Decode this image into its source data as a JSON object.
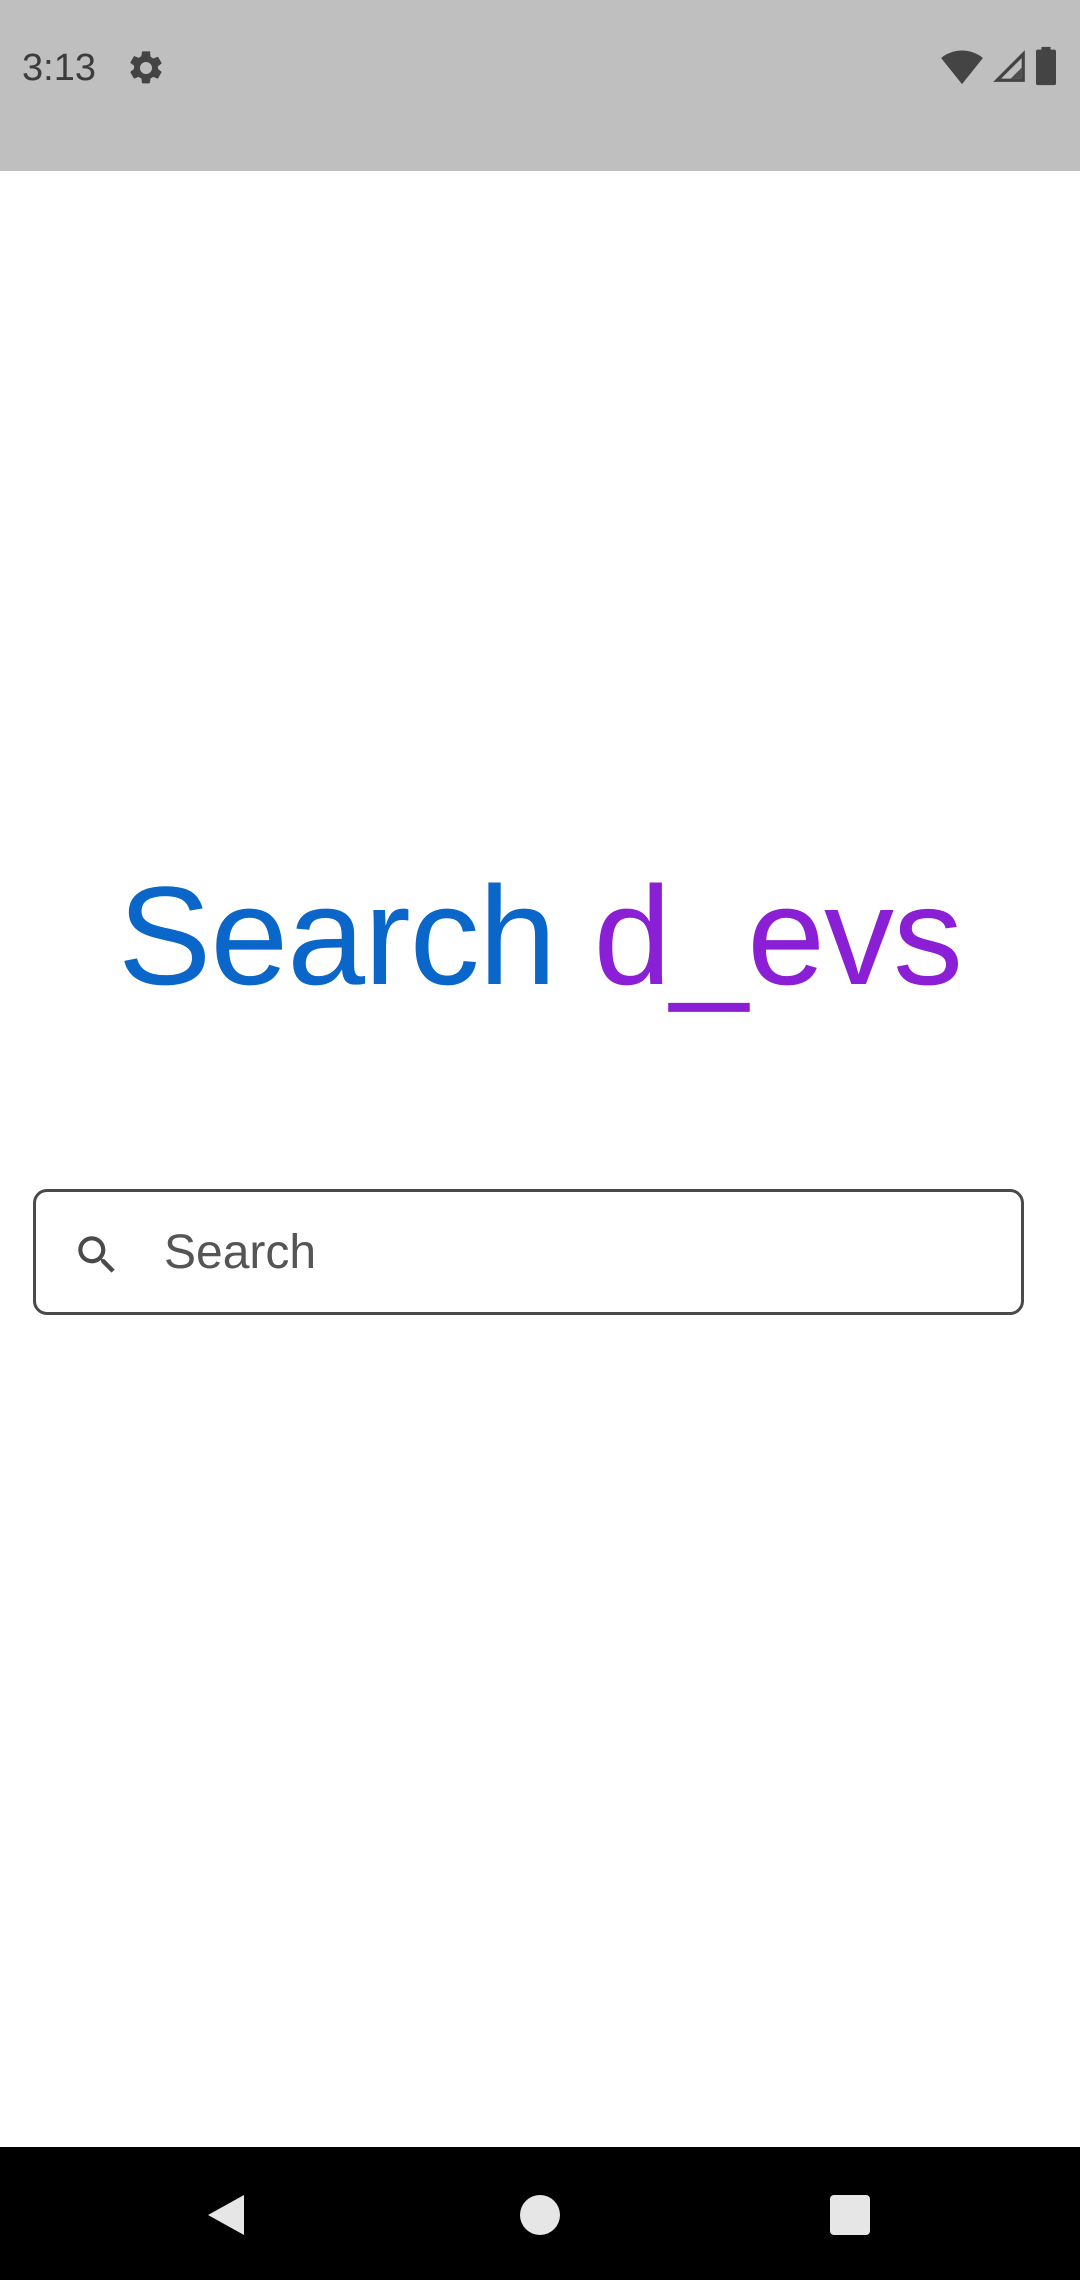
{
  "status_bar": {
    "time": "3:13",
    "icons": [
      "gear-icon",
      "wifi-icon",
      "signal-icon",
      "battery-icon"
    ]
  },
  "headline": {
    "part1": "Search",
    "part2": "d_evs",
    "color1": "#0a66c8",
    "color2": "#8a1fd6"
  },
  "search": {
    "placeholder": "Search",
    "value": ""
  },
  "nav_bar": {
    "buttons": [
      "back-icon",
      "home-icon",
      "recents-icon"
    ]
  }
}
